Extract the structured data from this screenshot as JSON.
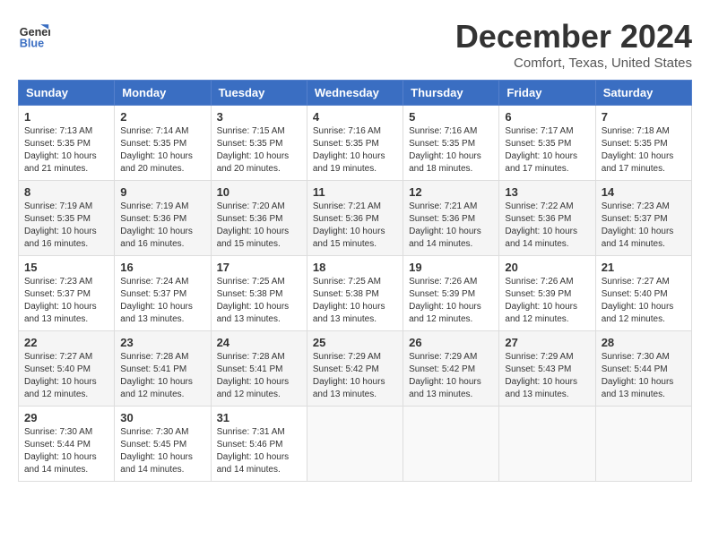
{
  "logo": {
    "line1": "General",
    "line2": "Blue"
  },
  "title": "December 2024",
  "location": "Comfort, Texas, United States",
  "days_of_week": [
    "Sunday",
    "Monday",
    "Tuesday",
    "Wednesday",
    "Thursday",
    "Friday",
    "Saturday"
  ],
  "weeks": [
    [
      {
        "day": "1",
        "sunrise": "7:13 AM",
        "sunset": "5:35 PM",
        "daylight": "10 hours and 21 minutes."
      },
      {
        "day": "2",
        "sunrise": "7:14 AM",
        "sunset": "5:35 PM",
        "daylight": "10 hours and 20 minutes."
      },
      {
        "day": "3",
        "sunrise": "7:15 AM",
        "sunset": "5:35 PM",
        "daylight": "10 hours and 20 minutes."
      },
      {
        "day": "4",
        "sunrise": "7:16 AM",
        "sunset": "5:35 PM",
        "daylight": "10 hours and 19 minutes."
      },
      {
        "day": "5",
        "sunrise": "7:16 AM",
        "sunset": "5:35 PM",
        "daylight": "10 hours and 18 minutes."
      },
      {
        "day": "6",
        "sunrise": "7:17 AM",
        "sunset": "5:35 PM",
        "daylight": "10 hours and 17 minutes."
      },
      {
        "day": "7",
        "sunrise": "7:18 AM",
        "sunset": "5:35 PM",
        "daylight": "10 hours and 17 minutes."
      }
    ],
    [
      {
        "day": "8",
        "sunrise": "7:19 AM",
        "sunset": "5:35 PM",
        "daylight": "10 hours and 16 minutes."
      },
      {
        "day": "9",
        "sunrise": "7:19 AM",
        "sunset": "5:36 PM",
        "daylight": "10 hours and 16 minutes."
      },
      {
        "day": "10",
        "sunrise": "7:20 AM",
        "sunset": "5:36 PM",
        "daylight": "10 hours and 15 minutes."
      },
      {
        "day": "11",
        "sunrise": "7:21 AM",
        "sunset": "5:36 PM",
        "daylight": "10 hours and 15 minutes."
      },
      {
        "day": "12",
        "sunrise": "7:21 AM",
        "sunset": "5:36 PM",
        "daylight": "10 hours and 14 minutes."
      },
      {
        "day": "13",
        "sunrise": "7:22 AM",
        "sunset": "5:36 PM",
        "daylight": "10 hours and 14 minutes."
      },
      {
        "day": "14",
        "sunrise": "7:23 AM",
        "sunset": "5:37 PM",
        "daylight": "10 hours and 14 minutes."
      }
    ],
    [
      {
        "day": "15",
        "sunrise": "7:23 AM",
        "sunset": "5:37 PM",
        "daylight": "10 hours and 13 minutes."
      },
      {
        "day": "16",
        "sunrise": "7:24 AM",
        "sunset": "5:37 PM",
        "daylight": "10 hours and 13 minutes."
      },
      {
        "day": "17",
        "sunrise": "7:25 AM",
        "sunset": "5:38 PM",
        "daylight": "10 hours and 13 minutes."
      },
      {
        "day": "18",
        "sunrise": "7:25 AM",
        "sunset": "5:38 PM",
        "daylight": "10 hours and 13 minutes."
      },
      {
        "day": "19",
        "sunrise": "7:26 AM",
        "sunset": "5:39 PM",
        "daylight": "10 hours and 12 minutes."
      },
      {
        "day": "20",
        "sunrise": "7:26 AM",
        "sunset": "5:39 PM",
        "daylight": "10 hours and 12 minutes."
      },
      {
        "day": "21",
        "sunrise": "7:27 AM",
        "sunset": "5:40 PM",
        "daylight": "10 hours and 12 minutes."
      }
    ],
    [
      {
        "day": "22",
        "sunrise": "7:27 AM",
        "sunset": "5:40 PM",
        "daylight": "10 hours and 12 minutes."
      },
      {
        "day": "23",
        "sunrise": "7:28 AM",
        "sunset": "5:41 PM",
        "daylight": "10 hours and 12 minutes."
      },
      {
        "day": "24",
        "sunrise": "7:28 AM",
        "sunset": "5:41 PM",
        "daylight": "10 hours and 12 minutes."
      },
      {
        "day": "25",
        "sunrise": "7:29 AM",
        "sunset": "5:42 PM",
        "daylight": "10 hours and 13 minutes."
      },
      {
        "day": "26",
        "sunrise": "7:29 AM",
        "sunset": "5:42 PM",
        "daylight": "10 hours and 13 minutes."
      },
      {
        "day": "27",
        "sunrise": "7:29 AM",
        "sunset": "5:43 PM",
        "daylight": "10 hours and 13 minutes."
      },
      {
        "day": "28",
        "sunrise": "7:30 AM",
        "sunset": "5:44 PM",
        "daylight": "10 hours and 13 minutes."
      }
    ],
    [
      {
        "day": "29",
        "sunrise": "7:30 AM",
        "sunset": "5:44 PM",
        "daylight": "10 hours and 14 minutes."
      },
      {
        "day": "30",
        "sunrise": "7:30 AM",
        "sunset": "5:45 PM",
        "daylight": "10 hours and 14 minutes."
      },
      {
        "day": "31",
        "sunrise": "7:31 AM",
        "sunset": "5:46 PM",
        "daylight": "10 hours and 14 minutes."
      },
      null,
      null,
      null,
      null
    ]
  ]
}
